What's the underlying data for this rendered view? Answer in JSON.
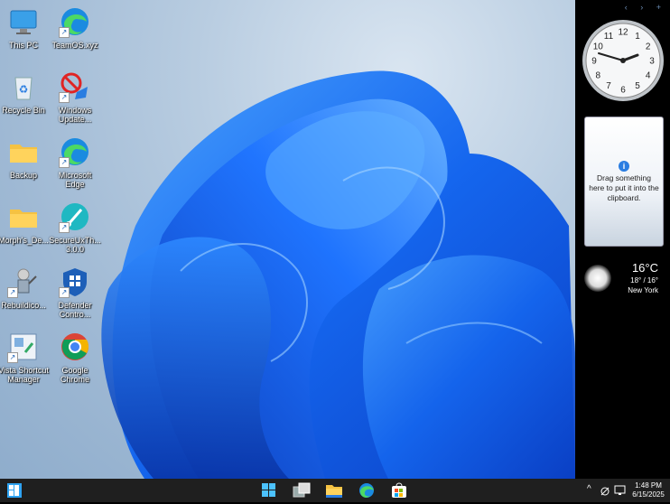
{
  "desktop_icons": [
    {
      "label": "This PC",
      "icon": "this-pc-icon"
    },
    {
      "label": "TeamOS.xyz",
      "icon": "edge-icon"
    },
    {
      "label": "Recycle Bin",
      "icon": "recycle-bin-icon"
    },
    {
      "label": "Windows Update...",
      "icon": "windows-update-icon"
    },
    {
      "label": "Backup",
      "icon": "folder-icon"
    },
    {
      "label": "Microsoft Edge",
      "icon": "edge-icon"
    },
    {
      "label": "Morph's_De...",
      "icon": "folder-icon"
    },
    {
      "label": "SecureUxTh... 3.0.0",
      "icon": "secureux-icon"
    },
    {
      "label": "Rebuildico...",
      "icon": "rebuild-icon"
    },
    {
      "label": "Defender Contro...",
      "icon": "defender-icon"
    },
    {
      "label": "Vista Shortcut Manager",
      "icon": "vista-shortcut-icon"
    },
    {
      "label": "Google Chrome",
      "icon": "chrome-icon"
    }
  ],
  "sidebar": {
    "controls": "‹ › +",
    "clock": {
      "numbers": [
        "12",
        "1",
        "2",
        "3",
        "4",
        "5",
        "6",
        "7",
        "8",
        "9",
        "10",
        "11"
      ],
      "time": "1:48"
    },
    "clipboard": {
      "info": "i",
      "text": "Drag something here to put it into the clipboard."
    },
    "weather": {
      "temp": "16°C",
      "range": "18° / 16°",
      "city": "New York"
    }
  },
  "taskbar": {
    "apps": [
      "start-icon",
      "windows-icon",
      "task-view-icon",
      "file-explorer-icon",
      "edge-icon",
      "store-icon"
    ],
    "tray": {
      "chevron": "^",
      "time": "1:48 PM",
      "date": "6/15/2025"
    }
  },
  "colors": {
    "accent": "#1a73e8",
    "taskbar": "#1f1f1f",
    "sidebar": "#000000"
  }
}
